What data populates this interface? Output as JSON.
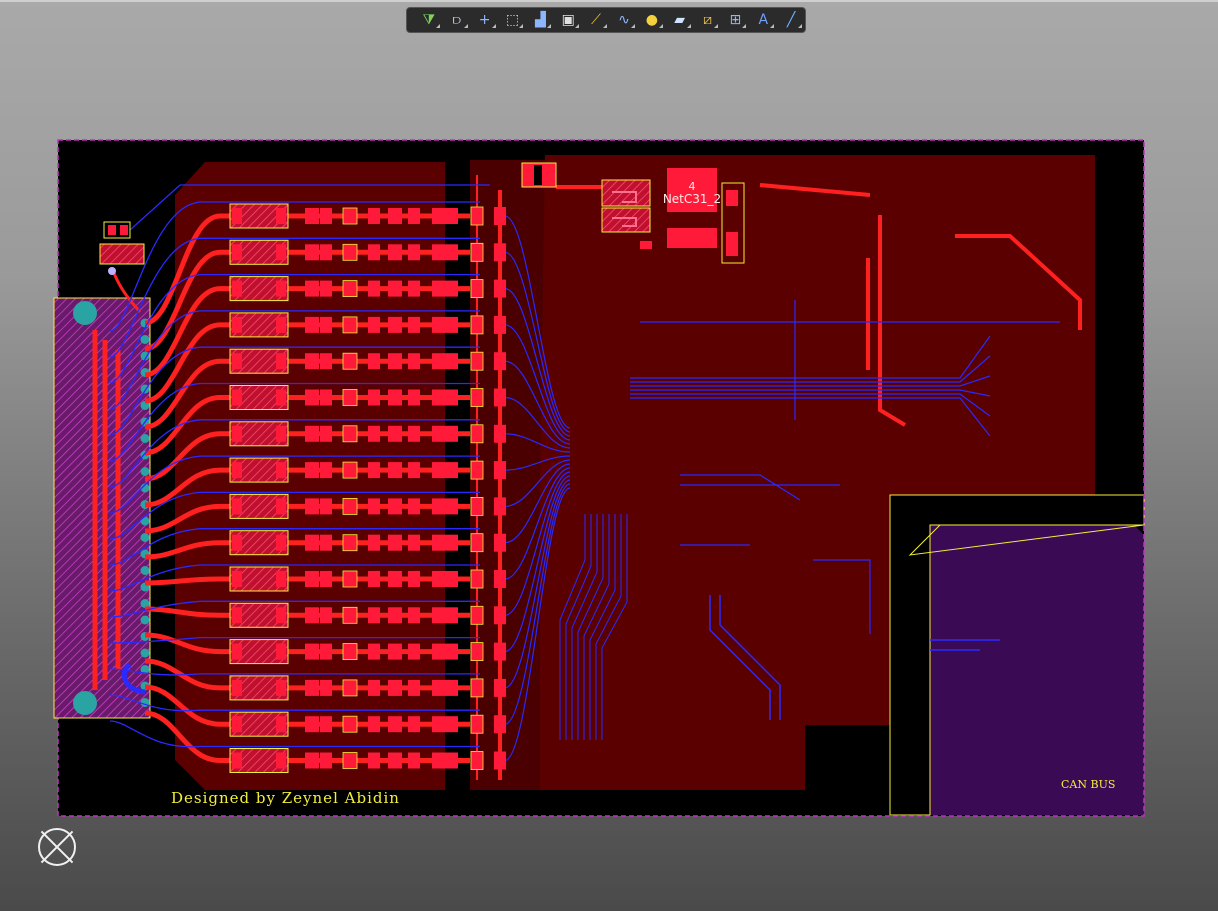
{
  "toolbar": {
    "tools": [
      {
        "icon": "filter-icon",
        "glyph": "⧩",
        "color": "#7fd35a"
      },
      {
        "icon": "route-interactive-icon",
        "glyph": "⫐",
        "color": "#cfd8ff"
      },
      {
        "icon": "cross-select-icon",
        "glyph": "+",
        "color": "#8fb4ff"
      },
      {
        "icon": "select-rectangle-icon",
        "glyph": "⬚",
        "color": "#cfd8ff"
      },
      {
        "icon": "align-icon",
        "glyph": "▟",
        "color": "#8fb4ff"
      },
      {
        "icon": "place-component-icon",
        "glyph": "▣",
        "color": "#e0e0e0"
      },
      {
        "icon": "route-track-icon",
        "glyph": "⟋",
        "color": "#f0c040"
      },
      {
        "icon": "differential-pair-icon",
        "glyph": "∿",
        "color": "#8fb4ff"
      },
      {
        "icon": "place-via-icon",
        "glyph": "●",
        "color": "#f4d03f"
      },
      {
        "icon": "polygon-pour-icon",
        "glyph": "▰",
        "color": "#d0e4ff"
      },
      {
        "icon": "place-line-icon",
        "glyph": "⧄",
        "color": "#f0c040"
      },
      {
        "icon": "dimension-icon",
        "glyph": "⊞",
        "color": "#8fb4ff"
      },
      {
        "icon": "place-string-icon",
        "glyph": "A",
        "color": "#6f9fff"
      },
      {
        "icon": "draw-line-icon",
        "glyph": "╱",
        "color": "#6fb4ff"
      }
    ]
  },
  "board": {
    "designer_text": "Designed by Zeynel Abidin",
    "net_label_number": "4",
    "net_label_name": "NetC31_2",
    "can_bus_label": "CAN BUS",
    "colors": {
      "background": "#000000",
      "copper_pour": "#5a0000",
      "top_copper": "#ff2020",
      "bottom_copper": "#2a2aff",
      "silkscreen": "#f4ee3a",
      "pads": "#ff1a3a",
      "outline": "#c030c0",
      "can_pour": "#3a0a55"
    }
  }
}
